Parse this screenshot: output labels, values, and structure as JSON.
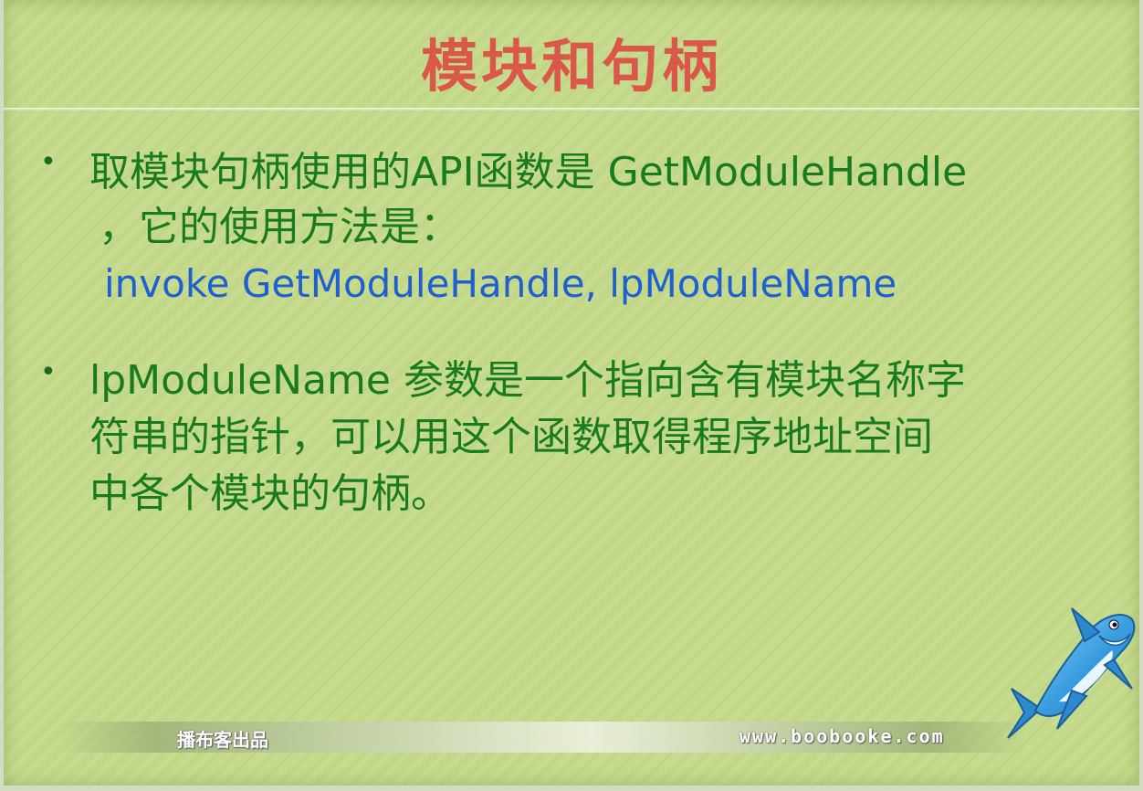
{
  "slide": {
    "title": "模块和句柄",
    "bullets": [
      {
        "lines": [
          "取模块句柄使用的API函数是 GetModuleHandle",
          "，它的使用方法是："
        ],
        "code": "invoke GetModuleHandle, lpModuleName"
      },
      {
        "lines": [
          "lpModuleName 参数是一个指向含有模块名称字",
          "符串的指针，可以用这个函数取得程序地址空间",
          "中各个模块的句柄。"
        ]
      }
    ]
  },
  "footer": {
    "publisher": "播布客出品",
    "website": "www.boobooke.com"
  },
  "logo": {
    "icon": "shark-mascot-icon"
  },
  "colors": {
    "background": "#c4d98a",
    "title": "#d9584a",
    "body_text": "#1a7a1f",
    "code_text": "#1f5fd0"
  }
}
